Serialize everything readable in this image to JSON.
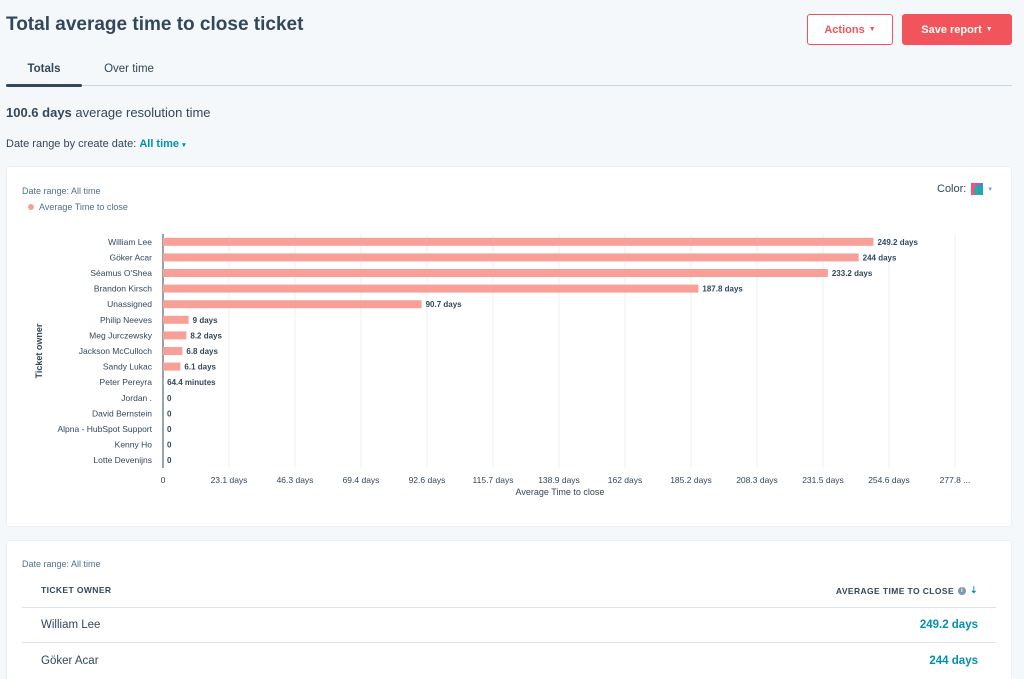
{
  "header": {
    "title": "Total average time to close ticket",
    "actions_label": "Actions",
    "save_label": "Save report"
  },
  "tabs": [
    {
      "label": "Totals",
      "active": true
    },
    {
      "label": "Over time",
      "active": false
    }
  ],
  "summary": {
    "value": "100.6 days",
    "text": "average resolution time"
  },
  "date_filter": {
    "label": "Date range by create date:",
    "value": "All time"
  },
  "chart_card": {
    "date_range": "Date range: All time",
    "legend": "Average Time to close",
    "color_label": "Color:"
  },
  "chart_data": {
    "type": "bar",
    "orientation": "horizontal",
    "categories": [
      "William Lee",
      "Göker Acar",
      "Séamus O'Shea",
      "Brandon Kirsch",
      "Unassigned",
      "Philip Neeves",
      "Meg Jurczewsky",
      "Jackson McCulloch",
      "Sandy Lukac",
      "Peter Pereyra",
      "Jordan .",
      "David Bernstein",
      "Alpna - HubSpot Support",
      "Kenny Ho",
      "Lotte Devenijns"
    ],
    "series": [
      {
        "name": "Average Time to close",
        "values": [
          249.2,
          244,
          233.2,
          187.8,
          90.7,
          9,
          8.2,
          6.8,
          6.1,
          0.0447,
          0,
          0,
          0,
          0,
          0
        ],
        "labels": [
          "249.2 days",
          "244 days",
          "233.2 days",
          "187.8 days",
          "90.7 days",
          "9 days",
          "8.2 days",
          "6.8 days",
          "6.1 days",
          "64.4 minutes",
          "0",
          "0",
          "0",
          "0",
          "0"
        ]
      }
    ],
    "xticks": [
      "0",
      "23.1 days",
      "46.3 days",
      "69.4 days",
      "92.6 days",
      "115.7 days",
      "138.9 days",
      "162 days",
      "185.2 days",
      "208.3 days",
      "231.5 days",
      "254.6 days",
      "277.8 ..."
    ],
    "xlim": [
      0,
      277.8
    ],
    "xlabel": "Average Time to close",
    "ylabel": "Ticket owner",
    "grid": true,
    "bar_color": "#f8a097"
  },
  "table": {
    "date_range": "Date range: All time",
    "headers": {
      "owner": "TICKET OWNER",
      "time": "AVERAGE TIME TO CLOSE"
    },
    "rows": [
      {
        "owner": "William Lee",
        "time": "249.2 days"
      },
      {
        "owner": "Göker Acar",
        "time": "244 days"
      }
    ]
  }
}
